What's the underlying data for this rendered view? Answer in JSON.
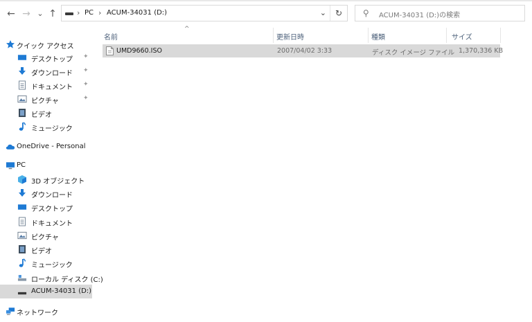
{
  "nav_buttons": {
    "back": "←",
    "forward": "→",
    "recent": "⌄",
    "up": "↑"
  },
  "address": {
    "crumbs": [
      "PC",
      "ACUM-34031 (D:)"
    ],
    "separator": "›",
    "dropdown": "⌄",
    "refresh": "↻"
  },
  "search": {
    "placeholder": "ACUM-34031 (D:)の検索"
  },
  "sidebar": {
    "quick_access": {
      "label": "クイック アクセス",
      "items": [
        {
          "label": "デスクトップ",
          "icon": "desktop-icon",
          "pinned": true
        },
        {
          "label": "ダウンロード",
          "icon": "download-icon",
          "pinned": true
        },
        {
          "label": "ドキュメント",
          "icon": "document-icon",
          "pinned": true
        },
        {
          "label": "ピクチャ",
          "icon": "picture-icon",
          "pinned": true
        },
        {
          "label": "ビデオ",
          "icon": "video-icon",
          "pinned": false
        },
        {
          "label": "ミュージック",
          "icon": "music-icon",
          "pinned": false
        }
      ]
    },
    "onedrive": {
      "label": "OneDrive - Personal"
    },
    "pc": {
      "label": "PC",
      "items": [
        {
          "label": "3D オブジェクト",
          "icon": "3d-objects-icon"
        },
        {
          "label": "ダウンロード",
          "icon": "download-icon"
        },
        {
          "label": "デスクトップ",
          "icon": "desktop-icon"
        },
        {
          "label": "ドキュメント",
          "icon": "document-icon"
        },
        {
          "label": "ピクチャ",
          "icon": "picture-icon"
        },
        {
          "label": "ビデオ",
          "icon": "video-icon"
        },
        {
          "label": "ミュージック",
          "icon": "music-icon"
        },
        {
          "label": "ローカル ディスク (C:)",
          "icon": "local-disk-icon"
        },
        {
          "label": "ACUM-34031 (D:)",
          "icon": "optical-drive-icon",
          "selected": true
        }
      ]
    },
    "network": {
      "label": "ネットワーク"
    },
    "pin_glyph": "✦"
  },
  "file_list": {
    "columns": {
      "name": "名前",
      "date": "更新日時",
      "type": "種類",
      "size": "サイズ"
    },
    "sort_indicator": "^",
    "rows": [
      {
        "name": "UMD9660.ISO",
        "date": "2007/04/02 3:33",
        "type": "ディスク イメージ ファイル",
        "size": "1,370,336 KB",
        "selected": true
      }
    ]
  },
  "colors": {
    "accent_blue": "#1e7ad4",
    "selected_grey": "#d9d9d9",
    "folder_yellow": "#f4c542"
  }
}
